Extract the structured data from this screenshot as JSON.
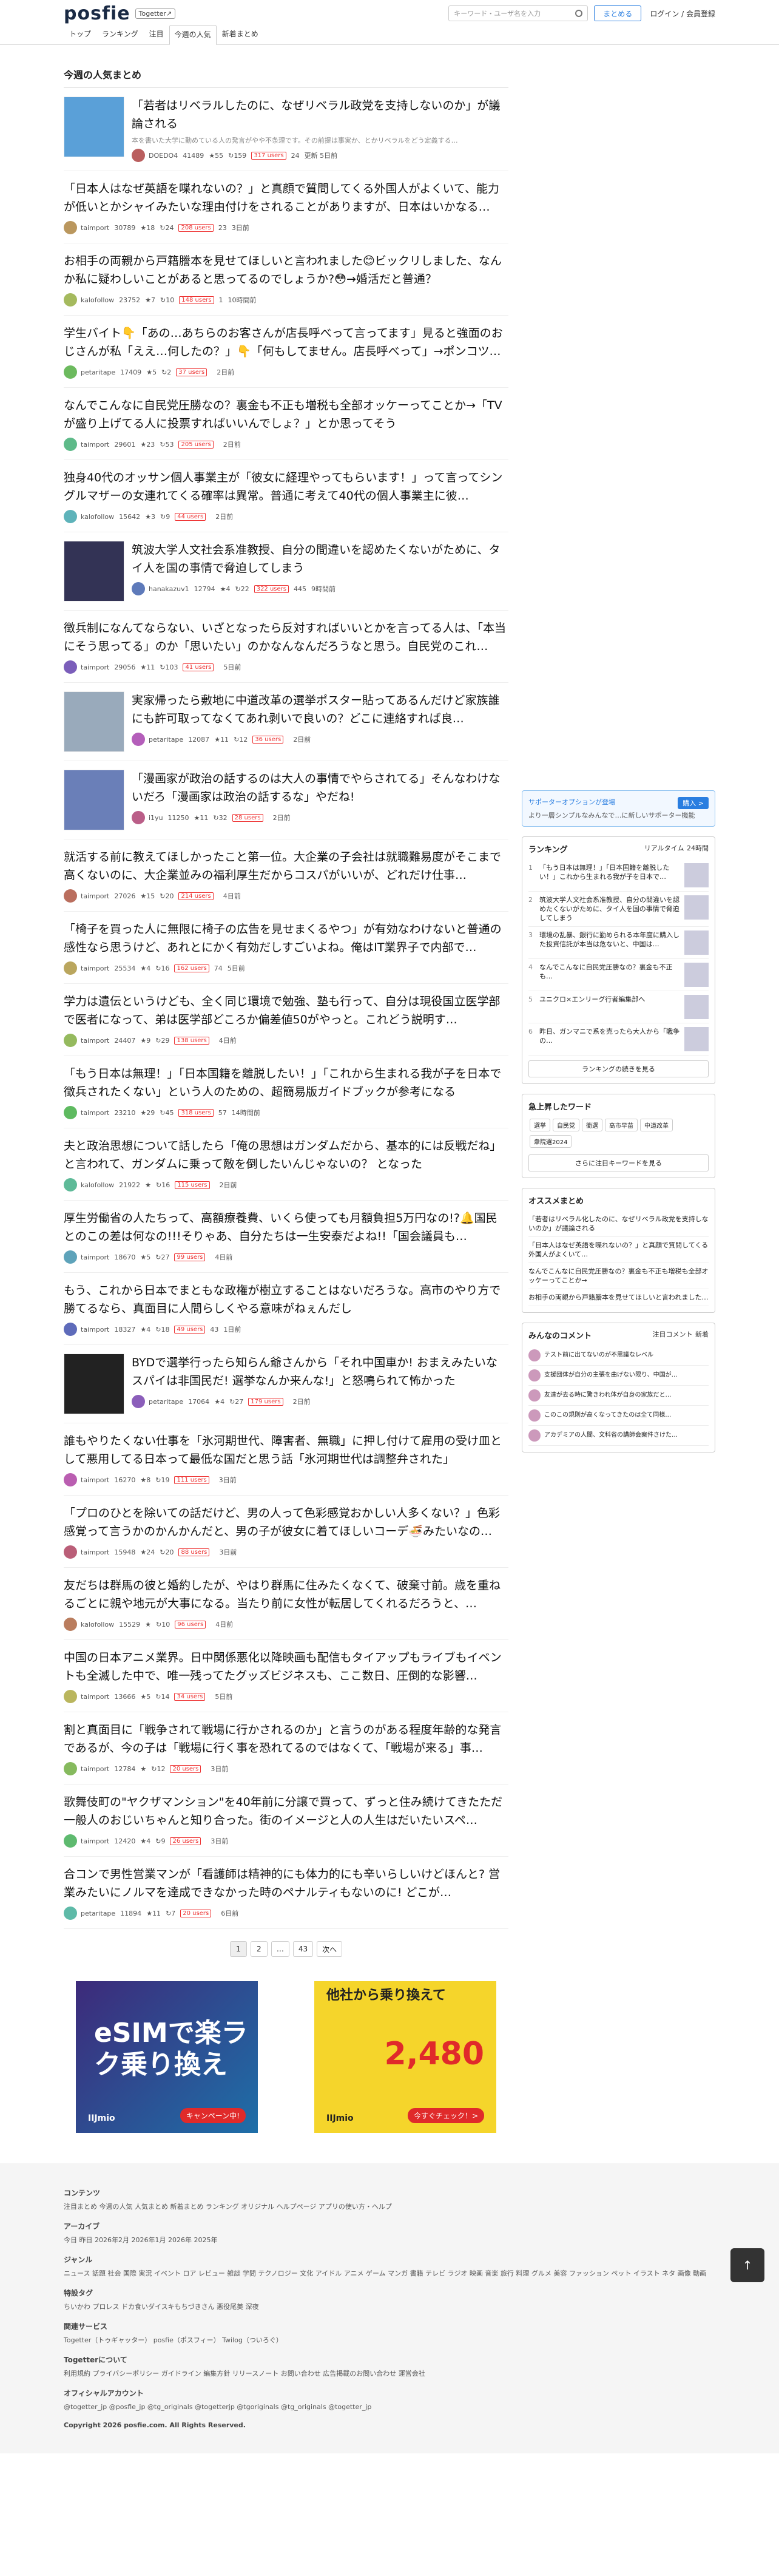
{
  "header": {
    "logo": "posfie",
    "logo_badge": "Togetter↗",
    "search_placeholder": "キーワード・ユーザ名を入力",
    "matome_button": "まとめる",
    "login": "ログイン / 会員登録"
  },
  "tabs": [
    "トップ",
    "ランキング",
    "注目",
    "今週の人気",
    "新着まとめ"
  ],
  "page_title": "今週の人気まとめ",
  "items": [
    {
      "title": "「若者はリベラルしたのに、なぜリベラル政党を支持しないのか」が議論される",
      "desc": "本を書いた大学に勤めている人の発言がやや不条理です。その前提は事実か、とかリベラルをどう定義する…",
      "user": "DOEDO4",
      "views": "41489",
      "stars": "55",
      "ret": "159",
      "users": "317 users",
      "extra": "24",
      "time": "更新 5日前",
      "thumb": "#5aa0d8"
    },
    {
      "title": "「日本人はなぜ英語を喋れないの？」と真顔で質問してくる外国人がよくいて、能力が低いとかシャイみたいな理由付けをされることがありますが、日本はいかなる…",
      "user": "taimport",
      "views": "30789",
      "stars": "18",
      "ret": "24",
      "users": "208 users",
      "extra": "23",
      "time": "3日前"
    },
    {
      "title": "お相手の両親から戸籍謄本を見せてほしいと言われました😊ビックリしました、なんか私に疑わしいことがあると思ってるのでしょうか?😳→婚活だと普通？",
      "user": "kalofollow",
      "views": "23752",
      "stars": "7",
      "ret": "10",
      "users": "148 users",
      "extra": "1",
      "time": "10時間前"
    },
    {
      "title": "学生バイト👇「あの…あちらのお客さんが店長呼べって言ってます」見ると強面のおじさんが私「ええ…何したの？」👇「何もしてません。店長呼べって」→ポンコツ…",
      "user": "petaritape",
      "views": "17409",
      "stars": "5",
      "ret": "2",
      "users": "37 users",
      "extra": "",
      "time": "2日前"
    },
    {
      "title": "なんでこんなに自民党圧勝なの？裏金も不正も増税も全部オッケーってことか→「TVが盛り上げてる人に投票すればいいんでしょ？」とか思ってそう",
      "user": "taimport",
      "views": "29601",
      "stars": "23",
      "ret": "53",
      "users": "205 users",
      "extra": "",
      "time": "2日前"
    },
    {
      "title": "独身40代のオッサン個人事業主が「彼女に経理やってもらいます！」って言ってシングルマザーの女連れてくる確率は異常。普通に考えて40代の個人事業主に彼…",
      "user": "kalofollow",
      "views": "15642",
      "stars": "3",
      "ret": "9",
      "users": "44 users",
      "extra": "",
      "time": "2日前"
    },
    {
      "title": "筑波大学人文社会系准教授、自分の間違いを認めたくないがために、タイ人を国の事情で脅迫してしまう",
      "desc": "",
      "user": "hanakazuv1",
      "views": "12794",
      "stars": "4",
      "ret": "22",
      "users": "322 users",
      "extra": "445",
      "time": "9時間前",
      "thumb": "#335"
    },
    {
      "title": "徴兵制になんてならない、いざとなったら反対すればいいとかを言ってる人は、「本当にそう思ってる」のか「思いたい」のかなんなんだろうなと思う。自民党のこれ…",
      "user": "taimport",
      "views": "29056",
      "stars": "11",
      "ret": "103",
      "users": "41 users",
      "extra": "",
      "time": "5日前"
    },
    {
      "title": "実家帰ったら敷地に中道改革の選挙ポスター貼ってあるんだけど家族誰にも許可取ってなくてあれ剥いで良いの？どこに連絡すれば良…",
      "user": "petaritape",
      "views": "12087",
      "stars": "11",
      "ret": "12",
      "users": "36 users",
      "extra": "",
      "time": "2日前",
      "thumb": "#9ab"
    },
    {
      "title": "「漫画家が政治の話するのは大人の事情でやらされてる」そんなわけないだろ「漫画家は政治の話するな」やだね!",
      "user": "i1yu",
      "views": "11250",
      "stars": "11",
      "ret": "32",
      "users": "28 users",
      "extra": "",
      "time": "2日前",
      "thumb": "#6a7fb8"
    },
    {
      "title": "就活する前に教えてほしかったこと第一位。大企業の子会社は就職難易度がそこまで高くないのに、大企業並みの福利厚生だからコスパがいいが、どれだけ仕事…",
      "user": "taimport",
      "views": "27026",
      "stars": "15",
      "ret": "20",
      "users": "214 users",
      "extra": "",
      "time": "4日前"
    },
    {
      "title": "「椅子を買った人に無限に椅子の広告を見せまくるやつ」が有効なわけないと普通の感性なら思うけど、あれとにかく有効だしすごいよね。俺はIT業界子で内部で…",
      "user": "taimport",
      "views": "25534",
      "stars": "4",
      "ret": "16",
      "users": "162 users",
      "extra": "74",
      "time": "5日前"
    },
    {
      "title": "学力は遺伝というけども、全く同じ環境で勉強、塾も行って、自分は現役国立医学部で医者になって、弟は医学部どころか偏差値50がやっと。これどう説明す…",
      "user": "taimport",
      "views": "24407",
      "stars": "9",
      "ret": "29",
      "users": "138 users",
      "extra": "",
      "time": "4日前"
    },
    {
      "title": "「もう日本は無理！」「日本国籍を離脱したい！」「これから生まれる我が子を日本で徴兵されたくない」という人のための、超簡易版ガイドブックが参考になる",
      "user": "taimport",
      "views": "23210",
      "stars": "29",
      "ret": "45",
      "users": "318 users",
      "extra": "57",
      "time": "14時間前"
    },
    {
      "title": "夫と政治思想について話したら「俺の思想はガンダムだから、基本的には反戦だね」と言われて、ガンダムに乗って敵を倒したいんじゃないの？ となった",
      "user": "kalofollow",
      "views": "21922",
      "stars": "",
      "ret": "16",
      "users": "115 users",
      "extra": "",
      "time": "2日前"
    },
    {
      "title": "厚生労働省の人たちって、高額療養費、いくら使っても月額負担5万円なの!?🔔国民とのこの差は何なの!!!そりゃあ、自分たちは一生安泰だよね!!「国会議員も…",
      "user": "taimport",
      "views": "18670",
      "stars": "5",
      "ret": "27",
      "users": "99 users",
      "extra": "",
      "time": "4日前"
    },
    {
      "title": "もう、これから日本でまともな政権が樹立することはないだろうな。高市のやり方で勝てるなら、真面目に人間らしくやる意味がねぇんだし",
      "user": "taimport",
      "views": "18327",
      "stars": "4",
      "ret": "18",
      "users": "49 users",
      "extra": "43",
      "time": "1日前"
    },
    {
      "title": "BYDで選挙行ったら知らん爺さんから「それ中国車か! おまえみたいなスパイは非国民だ! 選挙なんか来んな!」と怒鳴られて怖かった",
      "user": "petaritape",
      "views": "17064",
      "stars": "4",
      "ret": "27",
      "users": "179 users",
      "extra": "",
      "time": "2日前",
      "thumb": "#222"
    },
    {
      "title": "誰もやりたくない仕事を「氷河期世代、障害者、無職」に押し付けて雇用の受け皿として悪用してる日本って最低な国だと思う話「氷河期世代は調整弁された」",
      "user": "taimport",
      "views": "16270",
      "stars": "8",
      "ret": "19",
      "users": "111 users",
      "extra": "",
      "time": "3日前"
    },
    {
      "title": "「プロのひとを除いての話だけど、男の人って色彩感覚おかしい人多くない？」色彩感覚って言うかのかんかんだと、男の子が彼女に着てほしいコーデ🍜みたいなの…",
      "user": "taimport",
      "views": "15948",
      "stars": "24",
      "ret": "20",
      "users": "88 users",
      "extra": "",
      "time": "3日前"
    },
    {
      "title": "友だちは群馬の彼と婚約したが、やはり群馬に住みたくなくて、破棄寸前。歳を重ねるごとに親や地元が大事になる。当たり前に女性が転居してくれるだろうと、…",
      "user": "kalofollow",
      "views": "15529",
      "stars": "",
      "ret": "10",
      "users": "96 users",
      "extra": "",
      "time": "4日前"
    },
    {
      "title": "中国の日本アニメ業界。日中関係悪化以降映画も配信もタイアップもライブもイベントも全滅した中で、唯一残ってたグッズビジネスも、ここ数日、圧倒的な影響…",
      "user": "taimport",
      "views": "13666",
      "stars": "5",
      "ret": "14",
      "users": "34 users",
      "extra": "",
      "time": "5日前"
    },
    {
      "title": "割と真面目に「戦争されて戦場に行かされるのか」と言うのがある程度年齢的な発言であるが、今の子は「戦場に行く事を恐れてるのではなくて、「戦場が来る」事…",
      "user": "taimport",
      "views": "12784",
      "stars": "",
      "ret": "12",
      "users": "20 users",
      "extra": "",
      "time": "3日前"
    },
    {
      "title": "歌舞伎町の\"ヤクザマンション\"を40年前に分譲で買って、ずっと住み続けてきたただ一般人のおじいちゃんと知り合った。街のイメージと人の人生はだいたいスペ…",
      "user": "taimport",
      "views": "12420",
      "stars": "4",
      "ret": "9",
      "users": "26 users",
      "extra": "",
      "time": "3日前"
    },
    {
      "title": "合コンで男性営業マンが「看護師は精神的にも体力的にも辛いらしいけどほんと? 営業みたいにノルマを達成できなかった時のペナルティもないのに! どこが…",
      "user": "petaritape",
      "views": "11894",
      "stars": "11",
      "ret": "7",
      "users": "20 users",
      "extra": "",
      "time": "6日前"
    }
  ],
  "pager": [
    "1",
    "2",
    "…",
    "43",
    "次へ"
  ],
  "ads": {
    "ad1_text": "eSIMで楽ラク乗り換え",
    "ad1_cta": "キャンペーン中!",
    "ad2_text": "他社から乗り換えて",
    "ad2_price": "2,480",
    "ad2_cta": "今すぐチェック！>"
  },
  "sidebar": {
    "support_title": "サポーターオプションが登場",
    "support_btn": "購入 >",
    "support_desc": "より一層シンプルなみんなで…に新しいサポーター機能",
    "ranking_title": "ランキング",
    "ranking_tabs": [
      "リアルタイム",
      "24時間"
    ],
    "ranking": [
      {
        "n": "1",
        "t": "「もう日本は無理！」「日本国籍を離脱したい！」これから生まれる我が子を日本で…"
      },
      {
        "n": "2",
        "t": "筑波大学人文社会系准教授、自分の間違いを認めたくないがために、タイ人を国の事情で脅迫してしまう"
      },
      {
        "n": "3",
        "t": "環境の乱暴、銀行に勤められる本年度に購入した投資信託が本当は危ないと、中国は…"
      },
      {
        "n": "4",
        "t": "なんでこんなに自民党圧勝なの？裏金も不正も…"
      },
      {
        "n": "5",
        "t": "ユニクロ×エンリーグ行者編集部へ"
      },
      {
        "n": "6",
        "t": "昨日、ガンマニで系を売ったら大人から「戦争の…"
      }
    ],
    "ranking_more": "ランキングの続きを見る",
    "keywords_title": "急上昇したワード",
    "keywords": [
      "選挙",
      "自民党",
      "衝選",
      "高市早苗",
      "中道改革",
      "衆院選2024"
    ],
    "keywords_more": "さらに注目キーワードを見る",
    "recommend_title": "オススメまとめ",
    "recommend": [
      "「若者はリベラル化したのに、なぜリベラル政党を支持しないのか」が議論される",
      "「日本人はなぜ英語を喋れないの？」と真顔で質問してくる外国人がよくいて…",
      "なんでこんなに自民党圧勝なの？裏金も不正も増税も全部オッケーってことか→",
      "お相手の両親から戸籍謄本を見せてほしいと言われました…"
    ],
    "comments_title": "みんなのコメント",
    "comments_tabs": [
      "注目コメント",
      "新着"
    ],
    "comments": [
      "テスト前に出てないのが不思議なレベル",
      "支援団体が自分の主張を曲げない限り、中国が…",
      "友達が去る時に驚きわれ体が自身の家族だと…",
      "このこの規則が高くなってきたのは全て同様…",
      "アカデミアの人間、文科省の講師会案件さけた…"
    ]
  },
  "footer": {
    "contents_h": "コンテンツ",
    "contents": "注目まとめ 今週の人気 人気まとめ 新着まとめ ランキング オリジナル ヘルプページ アプリの使い方・ヘルプ",
    "archive_h": "アーカイブ",
    "archive": "今日 昨日 2026年2月 2026年1月 2026年 2025年",
    "genre_h": "ジャンル",
    "genre": "ニュース 話題 社会 国際 実況 イベント ロア レビュー 雑談 学問 テクノロジー 文化 アイドル アニメ ゲーム マンガ 書籍 テレビ ラジオ 映画 音楽 旅行 料理 グルメ 美容 ファッション ペット イラスト ネタ 画像 動画",
    "special_h": "特設タグ",
    "special": "ちいかわ プロレス ドカ食いダイスキもちづきさん 悪役尾美 深夜",
    "related_h": "関連サービス",
    "related": "Togetter（トゥギャッター） posfie（ポスフィー） Twilog（ついろぐ）",
    "about_h": "Togetterについて",
    "about": "利用規約 プライバシーポリシー ガイドライン 編集方針 リリースノート お問い合わせ 広告掲載のお問い合わせ 運営会社",
    "official_h": "オフィシャルアカウント",
    "official": "@togetter_jp @posfie_jp @tg_originals @togetterjp @tgoriginals @tg_originals @togetter_jp",
    "copyright": "Copyright 2026 posfie.com. All Rights Reserved."
  }
}
